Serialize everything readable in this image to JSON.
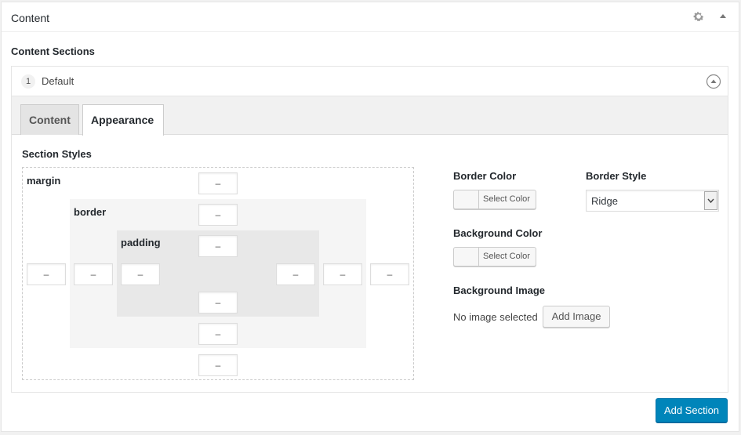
{
  "panel": {
    "title": "Content",
    "settings_icon": "gear-icon",
    "collapse_icon": "triangle-up-icon"
  },
  "content_sections": {
    "label": "Content Sections",
    "section": {
      "number": "1",
      "name": "Default",
      "toggle_icon": "circle-arrow-up-icon"
    }
  },
  "tabs": [
    {
      "label": "Content",
      "active": false
    },
    {
      "label": "Appearance",
      "active": true
    }
  ],
  "section_styles": {
    "label": "Section Styles",
    "margin_label": "margin",
    "border_label": "border",
    "padding_label": "padding",
    "values": {
      "margin_top": "–",
      "border_top": "–",
      "padding_top": "–",
      "margin_left": "–",
      "border_left": "–",
      "padding_left": "–",
      "padding_right": "–",
      "border_right": "–",
      "margin_right": "–",
      "padding_bottom": "–",
      "border_bottom": "–",
      "margin_bottom": "–"
    }
  },
  "appearance": {
    "border_color_label": "Border Color",
    "border_color_button": "Select Color",
    "border_style_label": "Border Style",
    "border_style_value": "Ridge",
    "background_color_label": "Background Color",
    "background_color_button": "Select Color",
    "background_image_label": "Background Image",
    "no_image_text": "No image selected",
    "add_image_button": "Add Image"
  },
  "footer": {
    "add_section_button": "Add Section"
  },
  "colors": {
    "primary": "#0085ba",
    "border": "#e5e5e5",
    "padding_zone": "#e8e8e8",
    "border_zone": "#f5f5f5"
  }
}
